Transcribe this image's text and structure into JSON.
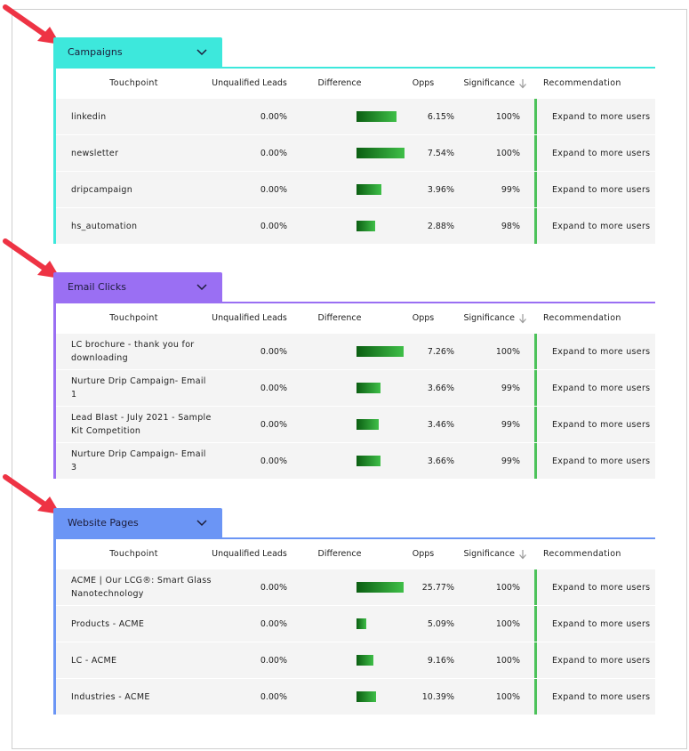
{
  "columns": {
    "touchpoint": "Touchpoint",
    "unqualified": "Unqualified Leads",
    "difference": "Difference",
    "opps": "Opps",
    "significance": "Significance",
    "recommendation": "Recommendation"
  },
  "colors": {
    "campaigns": "#3de8dc",
    "email_clicks": "#9a6ff3",
    "website_pages": "#6b95f5",
    "recommendation_accent": "#4cc25a",
    "arrow": "#ee3344"
  },
  "sections": [
    {
      "title": "Campaigns",
      "rows": [
        {
          "touchpoint": "linkedin",
          "unqualified": "0.00%",
          "diff": 0.62,
          "opps": "6.15%",
          "significance": "100%",
          "recommendation": "Expand to more users"
        },
        {
          "touchpoint": "newsletter",
          "unqualified": "0.00%",
          "diff": 0.75,
          "opps": "7.54%",
          "significance": "100%",
          "recommendation": "Expand to more users"
        },
        {
          "touchpoint": "dripcampaign",
          "unqualified": "0.00%",
          "diff": 0.39,
          "opps": "3.96%",
          "significance": "99%",
          "recommendation": "Expand to more users"
        },
        {
          "touchpoint": "hs_automation",
          "unqualified": "0.00%",
          "diff": 0.29,
          "opps": "2.88%",
          "significance": "98%",
          "recommendation": "Expand to more users"
        }
      ]
    },
    {
      "title": "Email Clicks",
      "rows": [
        {
          "touchpoint": "LC brochure - thank you for downloading",
          "unqualified": "0.00%",
          "diff": 0.73,
          "opps": "7.26%",
          "significance": "100%",
          "recommendation": "Expand to more users"
        },
        {
          "touchpoint": "Nurture Drip Campaign- Email 1",
          "unqualified": "0.00%",
          "diff": 0.37,
          "opps": "3.66%",
          "significance": "99%",
          "recommendation": "Expand to more users"
        },
        {
          "touchpoint": "Lead Blast - July 2021 - Sample Kit Competition",
          "unqualified": "0.00%",
          "diff": 0.35,
          "opps": "3.46%",
          "significance": "99%",
          "recommendation": "Expand to more users"
        },
        {
          "touchpoint": "Nurture Drip Campaign- Email 3",
          "unqualified": "0.00%",
          "diff": 0.37,
          "opps": "3.66%",
          "significance": "99%",
          "recommendation": "Expand to more users"
        }
      ]
    },
    {
      "title": "Website Pages",
      "rows": [
        {
          "touchpoint": "ACME | Our LCG®: Smart Glass Nanotechnology",
          "unqualified": "0.00%",
          "diff": 0.73,
          "opps": "25.77%",
          "significance": "100%",
          "recommendation": "Expand to more users"
        },
        {
          "touchpoint": "Products - ACME",
          "unqualified": "0.00%",
          "diff": 0.15,
          "opps": "5.09%",
          "significance": "100%",
          "recommendation": "Expand to more users"
        },
        {
          "touchpoint": "LC - ACME",
          "unqualified": "0.00%",
          "diff": 0.26,
          "opps": "9.16%",
          "significance": "100%",
          "recommendation": "Expand to more users"
        },
        {
          "touchpoint": "Industries - ACME",
          "unqualified": "0.00%",
          "diff": 0.3,
          "opps": "10.39%",
          "significance": "100%",
          "recommendation": "Expand to more users"
        }
      ]
    }
  ]
}
